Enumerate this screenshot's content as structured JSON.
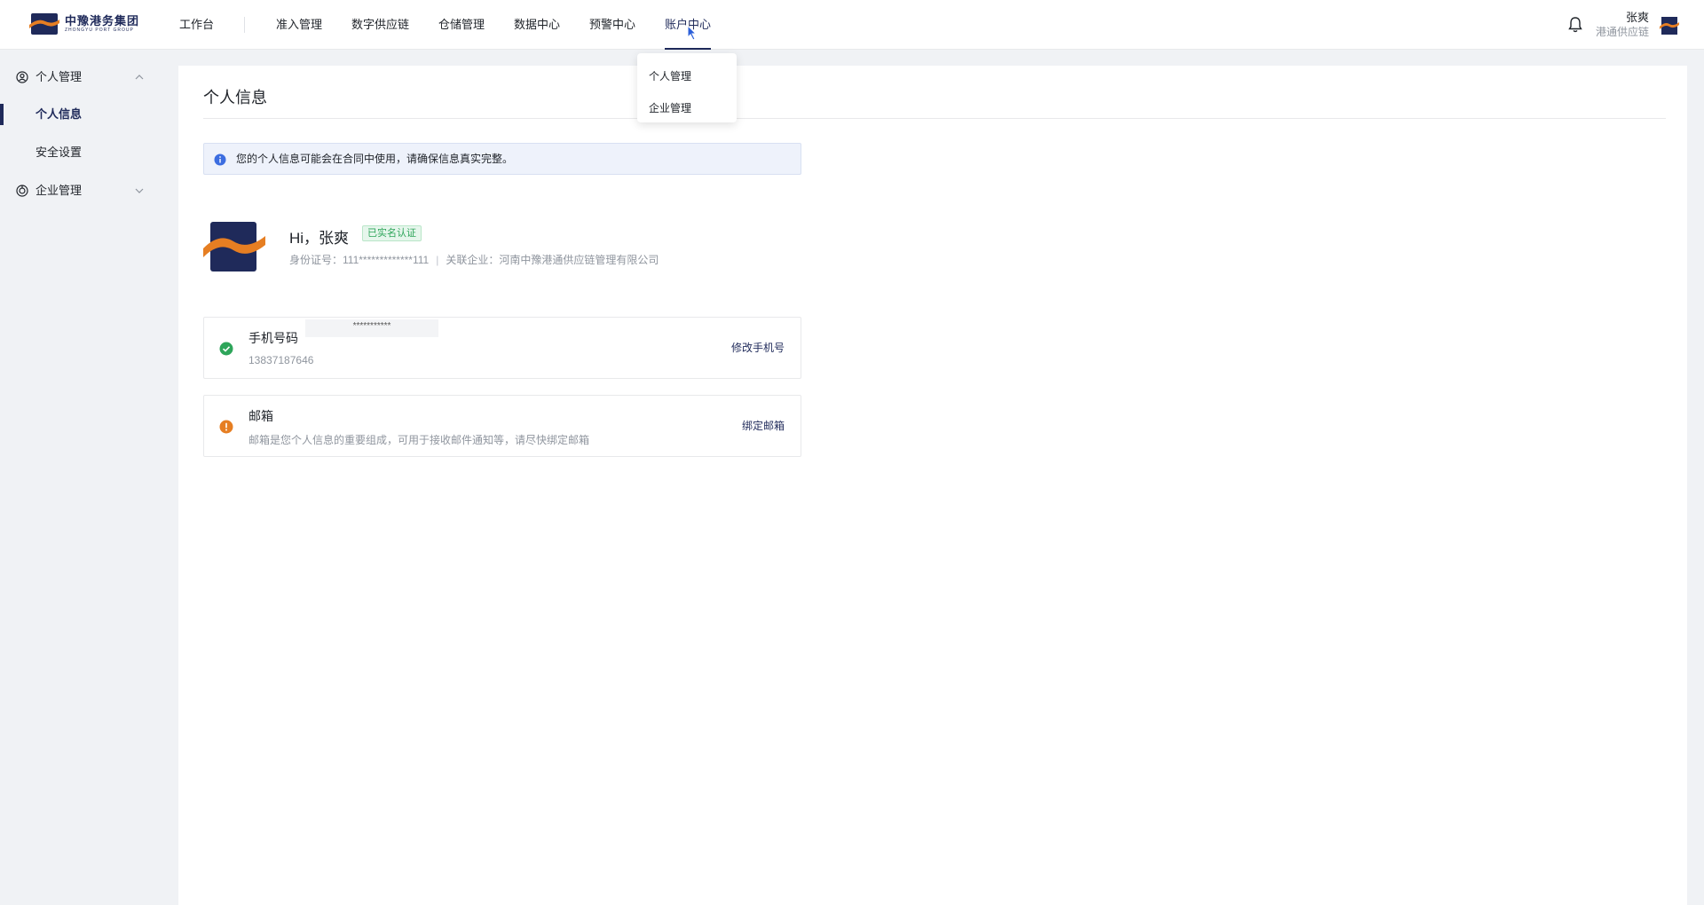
{
  "brand": {
    "name_cn": "中豫港务集团",
    "name_en": "ZHONGYU PORT GROUP",
    "colors": {
      "primary": "#1f2a5a",
      "accent": "#e67e22",
      "success": "#2ea55a",
      "warning": "#e67e22"
    }
  },
  "nav": {
    "items": [
      "工作台",
      "准入管理",
      "数字供应链",
      "仓储管理",
      "数据中心",
      "预警中心",
      "账户中心"
    ],
    "active": "账户中心"
  },
  "dropdown": {
    "items": [
      "个人管理",
      "企业管理"
    ]
  },
  "user": {
    "name": "张爽",
    "company": "港通供应链"
  },
  "sidebar": {
    "group_personal": "个人管理",
    "sub_items": [
      "个人信息",
      "安全设置"
    ],
    "selected": "个人信息",
    "group_enterprise": "企业管理"
  },
  "page": {
    "title": "个人信息",
    "notice": "您的个人信息可能会在合同中使用，请确保信息真实完整。",
    "greeting": "Hi，张爽",
    "verified_badge": "已实名认证",
    "id_label": "身份证号：",
    "id_value": "111*************111",
    "separator": "|",
    "company_label": "关联企业：",
    "company_value": "河南中豫港通供应链管理有限公司"
  },
  "phone_card": {
    "title": "手机号码",
    "value": "13837187646",
    "masked_tip": "***********",
    "action": "修改手机号",
    "status_icon": "check-circle-icon"
  },
  "email_card": {
    "title": "邮箱",
    "desc": "邮箱是您个人信息的重要组成，可用于接收邮件通知等，请尽快绑定邮箱",
    "action": "绑定邮箱",
    "status_icon": "warning-circle-icon"
  }
}
